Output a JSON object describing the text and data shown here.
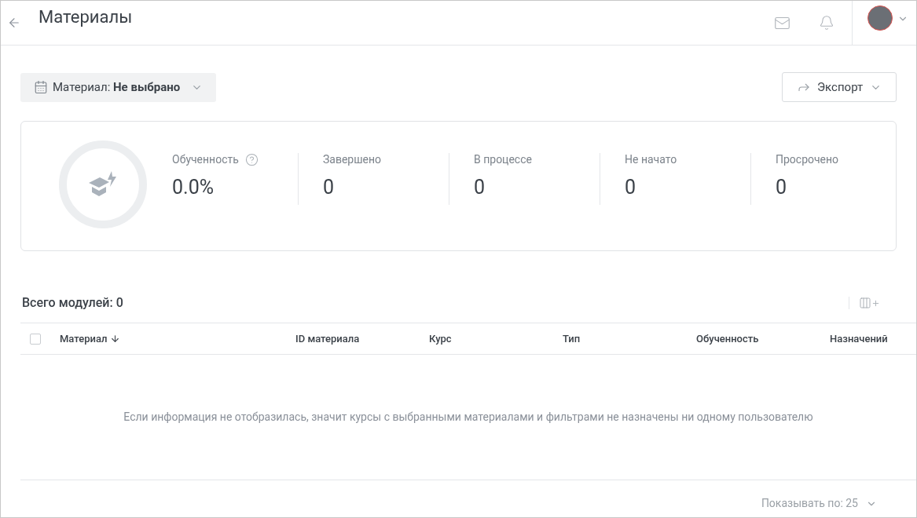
{
  "header": {
    "title": "Материалы"
  },
  "filter": {
    "label": "Материал: **Не выбрано**"
  },
  "export_button": {
    "label": "Экспорт"
  },
  "stats": [
    {
      "kind": "rate",
      "label": "Обученность",
      "value": "0.0%"
    },
    {
      "kind": "count",
      "label": "Завершено",
      "value": "0"
    },
    {
      "kind": "count",
      "label": "В процессе",
      "value": "0"
    },
    {
      "kind": "count",
      "label": "Не начато",
      "value": "0"
    },
    {
      "kind": "count",
      "label": "Просрочено",
      "value": "0"
    }
  ],
  "table": {
    "title": "Всего модулей: 0",
    "select_all_checked": false,
    "columns": [
      {
        "label": "Материал",
        "sorted": true
      },
      {
        "label": "ID материала",
        "sorted": false
      },
      {
        "label": "Курс",
        "sorted": false
      },
      {
        "label": "Тип",
        "sorted": false
      },
      {
        "label": "Обученность",
        "sorted": false
      },
      {
        "label": "Назначений",
        "sorted": false
      }
    ],
    "empty_message": "Если информация не отобразилась, значит курсы с выбранными материалами и фильтрами не назначены ни одному пользователю"
  },
  "pagination": {
    "label": "Показывать по: 25"
  }
}
